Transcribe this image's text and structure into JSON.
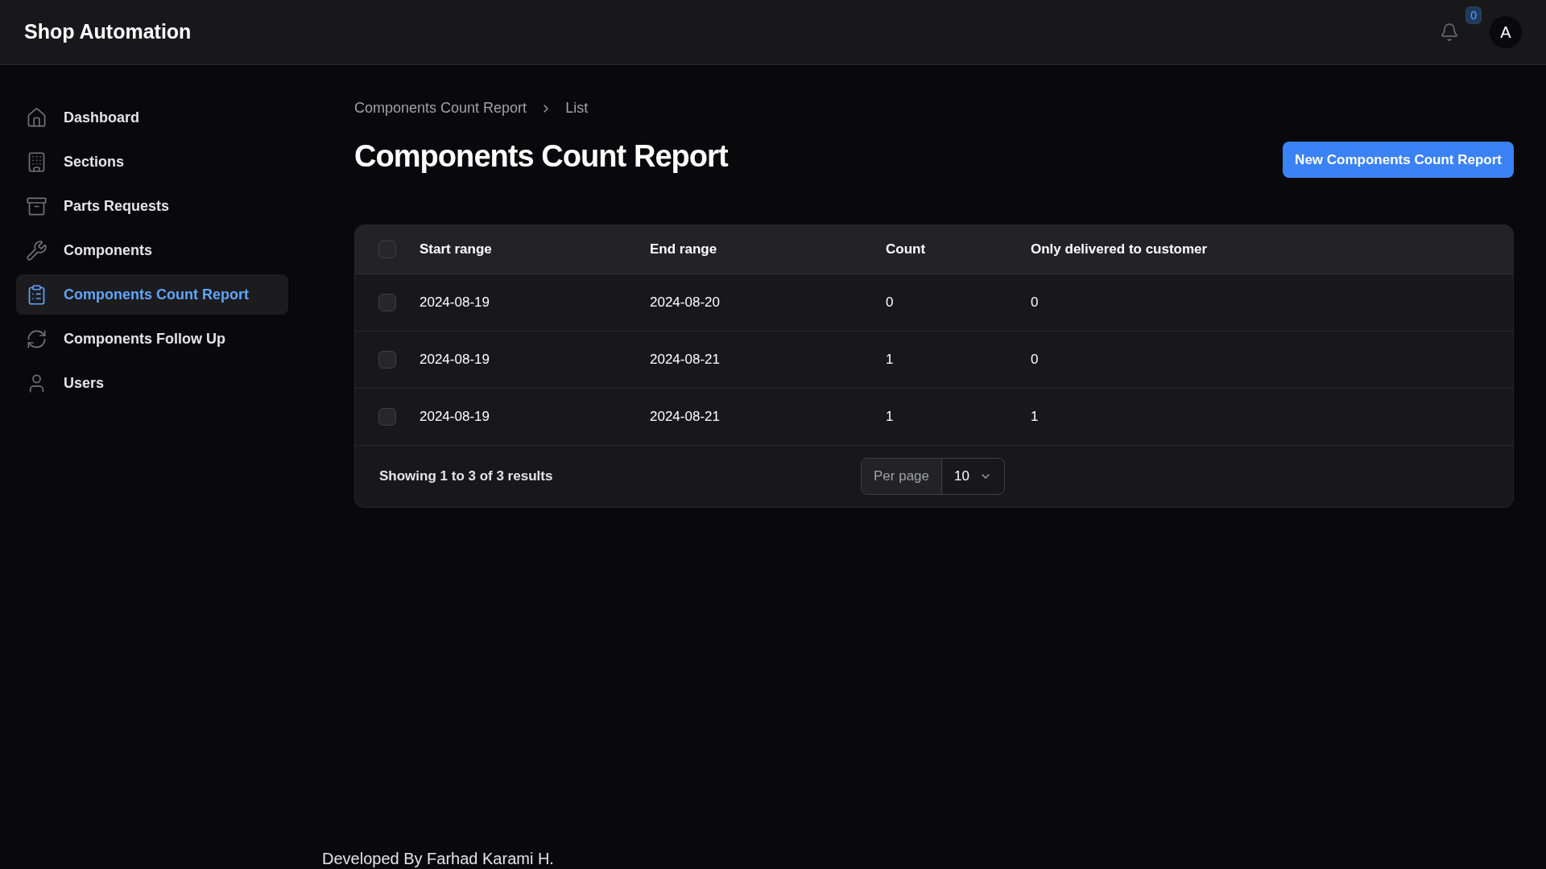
{
  "app": {
    "title": "Shop Automation",
    "notifications": {
      "count": "0"
    },
    "avatar": "A"
  },
  "sidebar": {
    "items": [
      {
        "label": "Dashboard",
        "selected": false
      },
      {
        "label": "Sections",
        "selected": false
      },
      {
        "label": "Parts Requests",
        "selected": false
      },
      {
        "label": "Components",
        "selected": false
      },
      {
        "label": "Components Count Report",
        "selected": true
      },
      {
        "label": "Components Follow Up",
        "selected": false
      },
      {
        "label": "Users",
        "selected": false
      }
    ]
  },
  "breadcrumb": [
    "Components Count Report",
    "List"
  ],
  "page": {
    "title": "Components Count Report",
    "action": "New Components Count Report"
  },
  "table": {
    "select_all_checked": false,
    "columns": [
      "Start range",
      "End range",
      "Count",
      "Only delivered to customer"
    ],
    "rows": [
      {
        "checked": false,
        "cells": [
          "2024-08-19",
          "2024-08-20",
          "0",
          "0"
        ]
      },
      {
        "checked": false,
        "cells": [
          "2024-08-19",
          "2024-08-21",
          "1",
          "0"
        ]
      },
      {
        "checked": false,
        "cells": [
          "2024-08-19",
          "2024-08-21",
          "1",
          "1"
        ]
      }
    ],
    "summary": "Showing 1 to 3 of 3 results",
    "per_page": {
      "label": "Per page",
      "value": "10"
    }
  },
  "footer": "Developed By Farhad Karami H."
}
